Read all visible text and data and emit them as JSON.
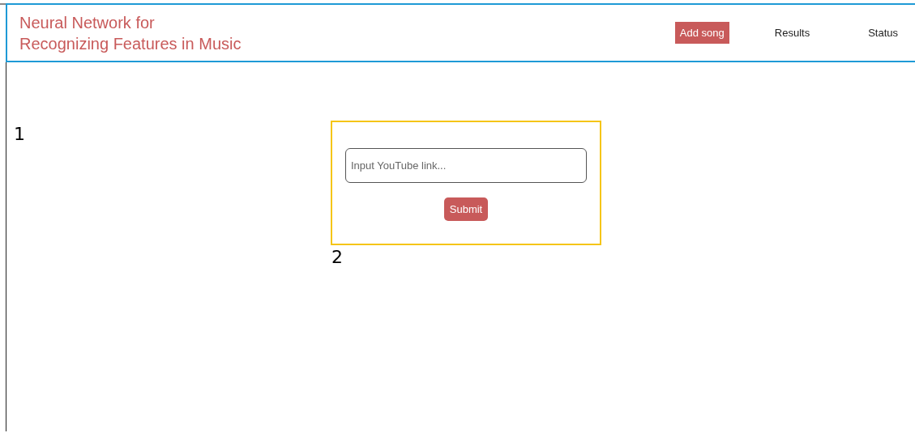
{
  "header": {
    "title_lines": [
      "Neural Network for",
      "Recognizing Features in Music"
    ],
    "nav": [
      {
        "label": "Add song",
        "selected": true
      },
      {
        "label": "Results",
        "selected": false
      },
      {
        "label": "Status",
        "selected": false
      }
    ]
  },
  "annotations": [
    "1",
    "2"
  ],
  "form": {
    "placeholder": "Input YouTube link...",
    "submit": "Submit"
  }
}
